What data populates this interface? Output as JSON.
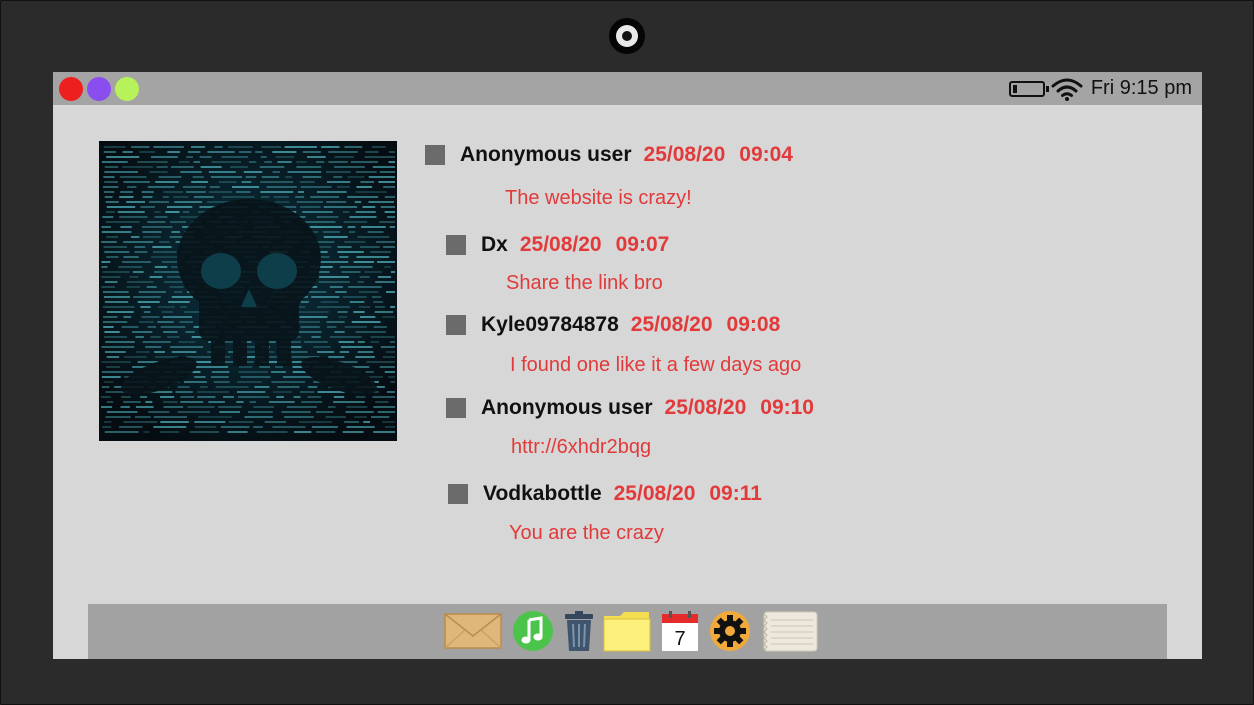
{
  "status_bar": {
    "clock": "Fri 9:15 pm",
    "battery_level": 0.15,
    "wifi_icon": "wifi-icon"
  },
  "window_buttons": {
    "close_color": "#ee1f1f",
    "minimize_color": "#8a4ef0",
    "maximize_color": "#b8f25a"
  },
  "comments": [
    {
      "author": "Anonymous user",
      "date": "25/08/20",
      "time": "09:04",
      "message": "The website is crazy!"
    },
    {
      "author": "Dx",
      "date": "25/08/20",
      "time": "09:07",
      "message": "Share the link bro"
    },
    {
      "author": "Kyle09784878",
      "date": "25/08/20",
      "time": "09:08",
      "message": "I found one like it a few days ago"
    },
    {
      "author": "Anonymous user",
      "date": "25/08/20",
      "time": "09:10",
      "message": "httr://6xhdr2bqg"
    },
    {
      "author": "Vodkabottle",
      "date": "25/08/20",
      "time": "09:11",
      "message": "You are the crazy"
    }
  ],
  "dock": {
    "calendar_day": "7",
    "items": [
      "mail-icon",
      "music-icon",
      "trash-icon",
      "folder-icon",
      "calendar-icon",
      "settings-icon",
      "notes-icon"
    ]
  },
  "colors": {
    "accent_red": "#e23a3a",
    "screen_bg": "#d7d7d7",
    "bar_gray": "#a4a4a4"
  }
}
